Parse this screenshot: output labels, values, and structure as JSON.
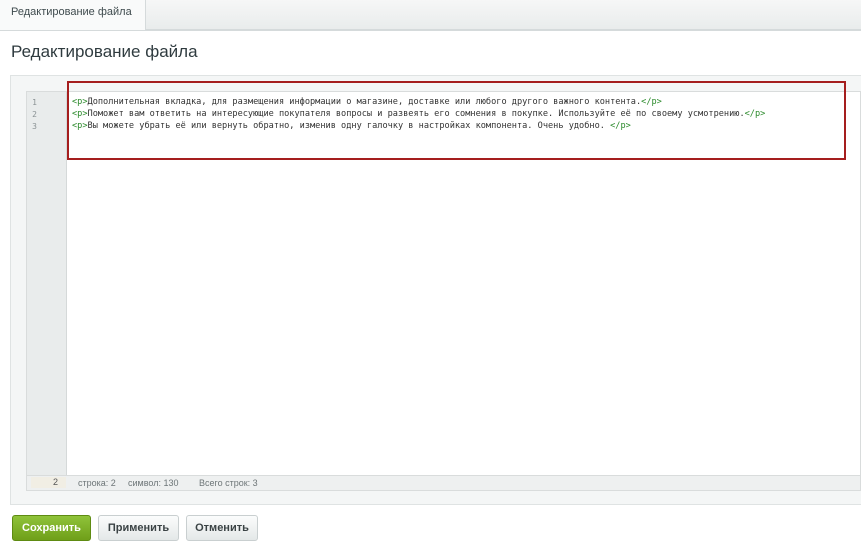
{
  "tab": {
    "label": "Редактирование файла"
  },
  "page": {
    "title": "Редактирование файла"
  },
  "editor": {
    "lines": [
      {
        "number": "1",
        "open_tag": "<p>",
        "text": "Дополнительная вкладка, для размещения информации о магазине, доставке или любого другого важного контента.",
        "close_tag": "</p>"
      },
      {
        "number": "2",
        "open_tag": "<p>",
        "text": "Поможет вам ответить на интересующие покупателя вопросы и развеять его сомнения в покупке. Используйте её по своему усмотрению.",
        "close_tag": "</p>"
      },
      {
        "number": "3",
        "open_tag": "<p>",
        "text": "Вы можете убрать её или вернуть обратно, изменив одну галочку в настройках компонента. Очень удобно. ",
        "close_tag": "</p>"
      }
    ]
  },
  "status": {
    "current_line": "2",
    "line_info": "строка: 2",
    "char_info": "символ: 130",
    "total_info": "Всего строк: 3"
  },
  "buttons": {
    "save": "Сохранить",
    "apply": "Применить",
    "cancel": "Отменить"
  },
  "colors": {
    "save_button": "#7bae22",
    "highlight_border": "#a51e1e",
    "tag_color": "#2b8a2b"
  }
}
